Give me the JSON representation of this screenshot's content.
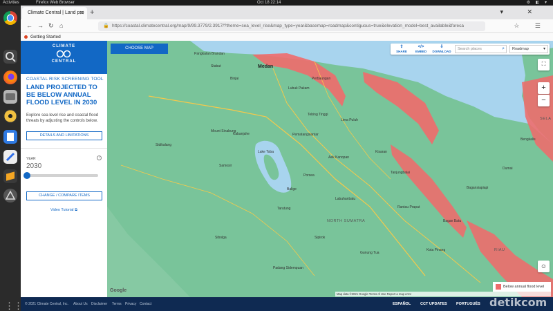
{
  "topbar": {
    "activities": "Activities",
    "app": "Firefox Web Browser",
    "clock": "Oct 18  22:14"
  },
  "browser": {
    "tab_title": "Climate Central | Land pro",
    "url": "https://coastal.climatecentral.org/map/9/99.3779/2.3917/?theme=sea_level_rise&map_type=year&basemap=roadmap&contiguous=true&elevation_model=best_available&foreca",
    "bookmark": "Getting Started"
  },
  "sidebar": {
    "logo_top": "CLIMATE",
    "logo_bottom": "CENTRAL",
    "eyebrow": "COASTAL RISK SCREENING TOOL",
    "title": "LAND PROJECTED TO BE BELOW ANNUAL FLOOD LEVEL IN 2030",
    "description": "Explore sea level rise and coastal flood threats by adjusting the controls below.",
    "details_button": "DETAILS AND LIMITATIONS",
    "year_label": "YEAR",
    "year_value": "2030",
    "year_slider_fraction": 0,
    "compare_button": "CHANGE / COMPARE ITEMS",
    "tutorial": "Video Tutorial"
  },
  "map": {
    "choose_map": "CHOOSE MAP",
    "tools": {
      "share": "SHARE",
      "embed": "EMBED",
      "download": "DOWNLOAD"
    },
    "search_placeholder": "Search places",
    "basemap": "Roadmap",
    "zoom_in": "+",
    "zoom_out": "−",
    "legend": "Below annual flood level",
    "google": "Google",
    "attribution": "Map data ©2021 Google  Terms of Use  Report a map error",
    "flood_color": "#ef6b6b",
    "land_color": "#79c49a",
    "sea_color": "#a8d4ee",
    "places": [
      {
        "name": "Medan",
        "big": true
      },
      {
        "name": "Tebing Tinggi"
      },
      {
        "name": "Pematangsiantar"
      },
      {
        "name": "Kabanjahe"
      },
      {
        "name": "Sidikalang"
      },
      {
        "name": "Lake Toba"
      },
      {
        "name": "Samosir"
      },
      {
        "name": "Balige"
      },
      {
        "name": "Tarutung"
      },
      {
        "name": "Kisaran"
      },
      {
        "name": "Rantau Prapat"
      },
      {
        "name": "Padang Sidempuan"
      },
      {
        "name": "Sibolga"
      },
      {
        "name": "Tanjungbalai"
      },
      {
        "name": "Aek Kanopan"
      },
      {
        "name": "Labuhanbatu"
      },
      {
        "name": "Kota Pinang"
      },
      {
        "name": "Pangkalan Brandan"
      },
      {
        "name": "Binjai"
      },
      {
        "name": "Stabat"
      },
      {
        "name": "Lubuk Pakam"
      },
      {
        "name": "Perbaungan"
      },
      {
        "name": "Lima Puluh"
      },
      {
        "name": "Mount Sinabung"
      },
      {
        "name": "Porsea"
      },
      {
        "name": "Sipirok"
      },
      {
        "name": "Gunung Tua"
      },
      {
        "name": "Bagan Batu"
      },
      {
        "name": "Bagansiapiapi"
      },
      {
        "name": "Dumai"
      },
      {
        "name": "Bengkalis"
      }
    ],
    "regions": [
      {
        "name": "NORTH SUMATRA"
      },
      {
        "name": "RIAU"
      },
      {
        "name": "SELA"
      }
    ]
  },
  "footer": {
    "copyright": "© 2021 Climate Central, Inc.",
    "links": [
      "About Us",
      "Disclaimer",
      "Terms",
      "Privacy",
      "Contact"
    ],
    "right": [
      "ESPAÑOL",
      "CCT UPDATES",
      "PORTUGUÊS"
    ]
  },
  "watermark": "detikcom"
}
